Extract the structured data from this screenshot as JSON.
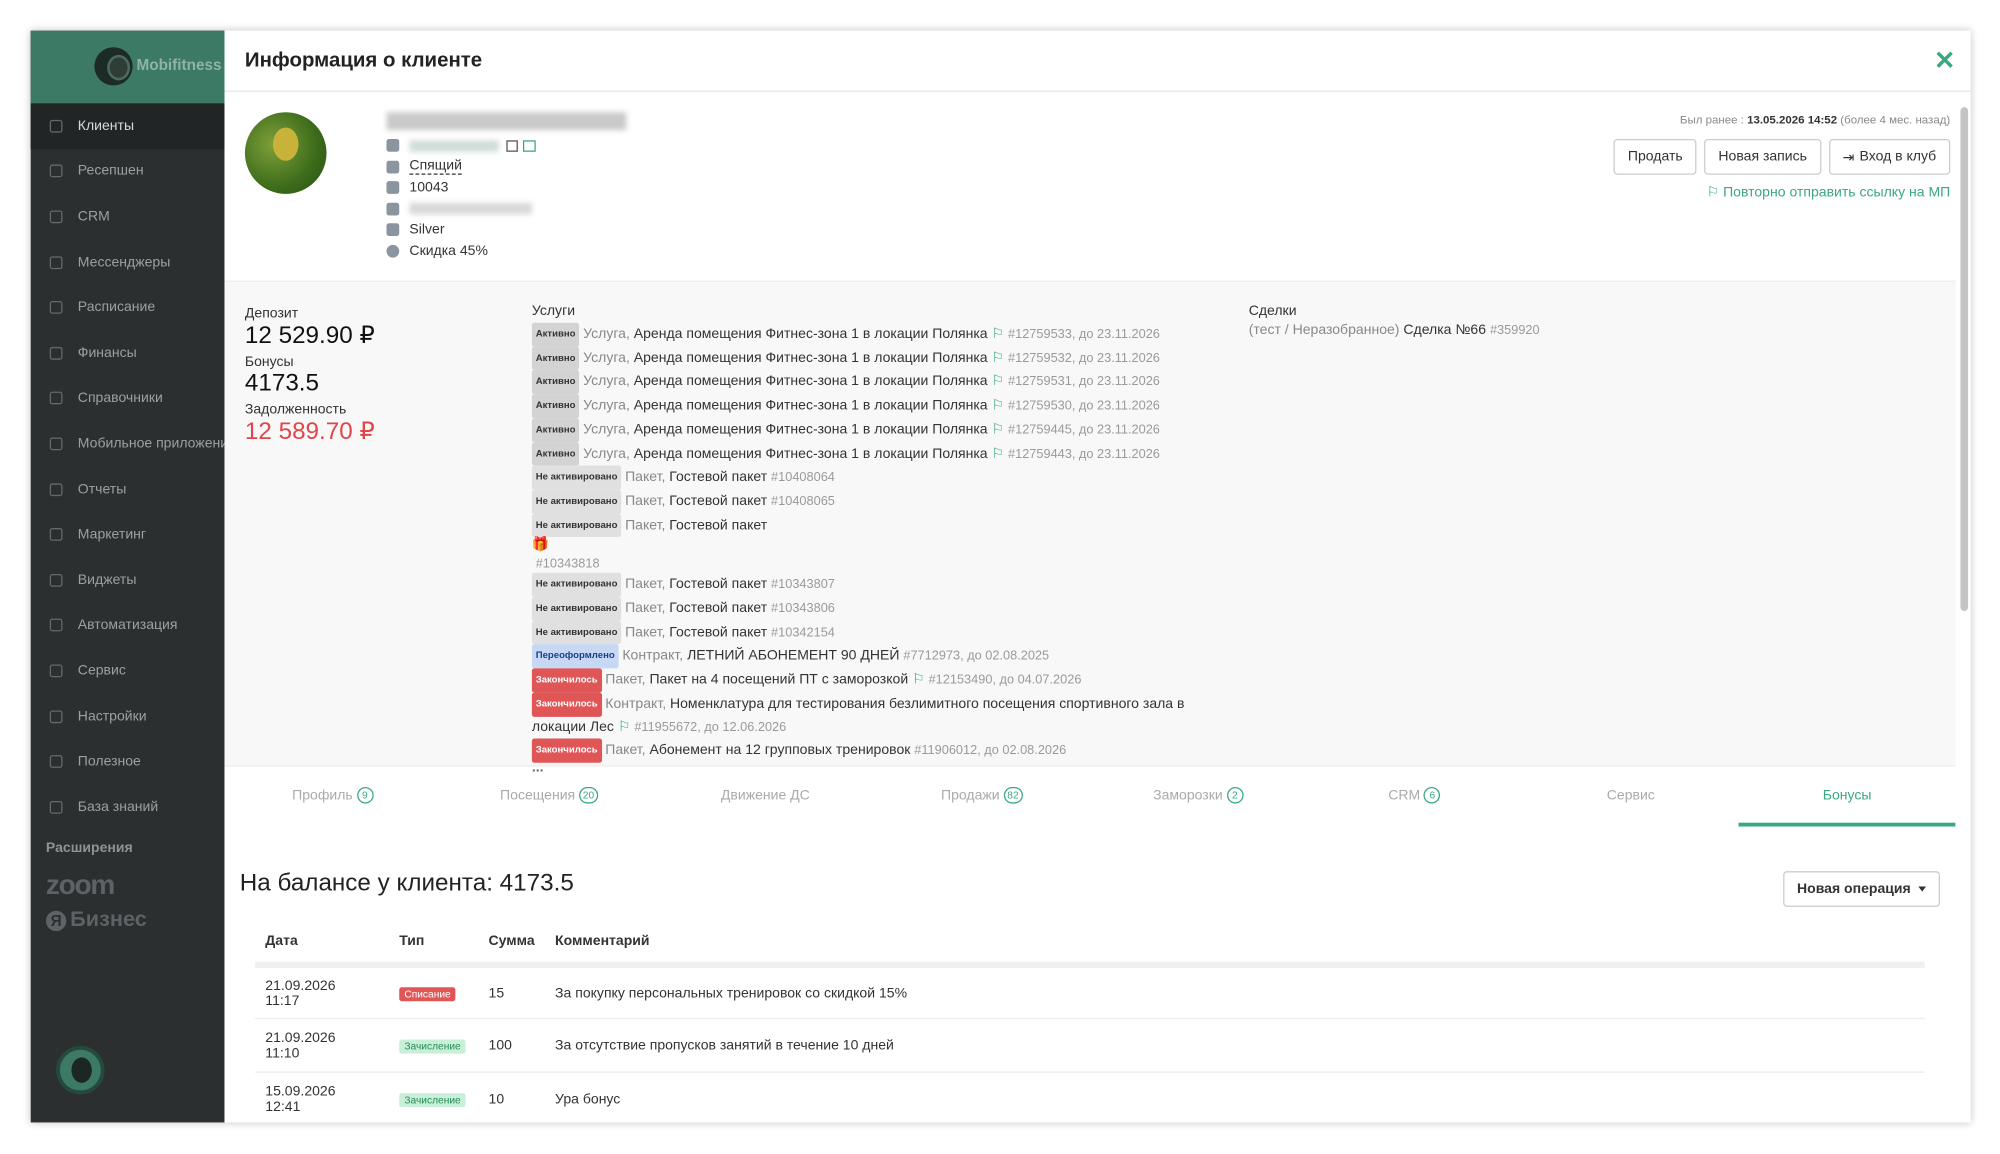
{
  "sidebar": {
    "logo_text": "Mobifitness",
    "items": [
      {
        "label": "Клиенты",
        "icon": "users-icon"
      },
      {
        "label": "Ресепшен",
        "icon": "reception-icon"
      },
      {
        "label": "CRM",
        "icon": "list-icon"
      },
      {
        "label": "Мессенджеры",
        "icon": "chat-icon"
      },
      {
        "label": "Расписание",
        "icon": "calendar-icon"
      },
      {
        "label": "Финансы",
        "icon": "cart-icon"
      },
      {
        "label": "Справочники",
        "icon": "home-icon"
      },
      {
        "label": "Мобильное приложение",
        "icon": "mobile-icon"
      },
      {
        "label": "Отчеты",
        "icon": "chart-icon"
      },
      {
        "label": "Маркетинг",
        "icon": "megaphone-icon"
      },
      {
        "label": "Виджеты",
        "icon": "tag-icon"
      },
      {
        "label": "Автоматизация",
        "icon": "rocket-icon"
      },
      {
        "label": "Сервис",
        "icon": "wrench-icon"
      },
      {
        "label": "Настройки",
        "icon": "gear-icon"
      },
      {
        "label": "Полезное",
        "icon": "thumbs-up-icon"
      },
      {
        "label": "База знаний",
        "icon": "help-icon"
      }
    ],
    "extensions_title": "Расширения",
    "ext_zoom": "zoom",
    "ext_ya_letter": "Я",
    "ext_ya": "Бизнес"
  },
  "header": {
    "title": "Информация о клиенте",
    "close": "✕"
  },
  "client": {
    "status": "Спящий",
    "card": "10043",
    "level": "Silver",
    "discount": "Скидка 45%",
    "last_visit_label": "Был ранее :",
    "last_visit_date": "13.05.2026 14:52",
    "last_visit_rel": "(более 4 мес. назад)"
  },
  "actions": {
    "sell": "Продать",
    "new_record": "Новая запись",
    "enter": "Вход в клуб",
    "resend": "Повторно отправить ссылку на МП"
  },
  "finance": {
    "deposit_label": "Депозит",
    "deposit": "12 529.90 ₽",
    "bonus_label": "Бонусы",
    "bonus": "4173.5",
    "debt_label": "Задолженность",
    "debt": "12 589.70 ₽"
  },
  "services": {
    "title": "Услуги",
    "gift_id": "#10343818",
    "ellipsis": "...",
    "rows": [
      {
        "badge": "Активно",
        "cls": "b-active",
        "kind": "Услуга,",
        "name": "Аренда помещения Фитнес-зона 1 в локации Полянка",
        "flag": true,
        "meta": "#12759533, до 23.11.2026"
      },
      {
        "badge": "Активно",
        "cls": "b-active",
        "kind": "Услуга,",
        "name": "Аренда помещения Фитнес-зона 1 в локации Полянка",
        "flag": true,
        "meta": "#12759532, до 23.11.2026"
      },
      {
        "badge": "Активно",
        "cls": "b-active",
        "kind": "Услуга,",
        "name": "Аренда помещения Фитнес-зона 1 в локации Полянка",
        "flag": true,
        "meta": "#12759531, до 23.11.2026"
      },
      {
        "badge": "Активно",
        "cls": "b-active",
        "kind": "Услуга,",
        "name": "Аренда помещения Фитнес-зона 1 в локации Полянка",
        "flag": true,
        "meta": "#12759530, до 23.11.2026"
      },
      {
        "badge": "Активно",
        "cls": "b-active",
        "kind": "Услуга,",
        "name": "Аренда помещения Фитнес-зона 1 в локации Полянка",
        "flag": true,
        "meta": "#12759445, до 23.11.2026"
      },
      {
        "badge": "Активно",
        "cls": "b-active",
        "kind": "Услуга,",
        "name": "Аренда помещения Фитнес-зона 1 в локации Полянка",
        "flag": true,
        "meta": "#12759443, до 23.11.2026"
      },
      {
        "badge": "Не активировано",
        "cls": "b-inactive",
        "kind": "Пакет,",
        "name": "Гостевой пакет",
        "flag": false,
        "meta": "#10408064"
      },
      {
        "badge": "Не активировано",
        "cls": "b-inactive",
        "kind": "Пакет,",
        "name": "Гостевой пакет",
        "flag": false,
        "meta": "#10408065"
      },
      {
        "badge": "Не активировано",
        "cls": "b-inactive",
        "kind": "Пакет,",
        "name": "Гостевой пакет",
        "flag": false,
        "meta": ""
      },
      {
        "gift": true
      },
      {
        "badge": "Не активировано",
        "cls": "b-inactive",
        "kind": "Пакет,",
        "name": "Гостевой пакет",
        "flag": false,
        "meta": "#10343807"
      },
      {
        "badge": "Не активировано",
        "cls": "b-inactive",
        "kind": "Пакет,",
        "name": "Гостевой пакет",
        "flag": false,
        "meta": "#10343806"
      },
      {
        "badge": "Не активировано",
        "cls": "b-inactive",
        "kind": "Пакет,",
        "name": "Гостевой пакет",
        "flag": false,
        "meta": "#10342154"
      },
      {
        "badge": "Переоформлено",
        "cls": "b-reissued",
        "kind": "Контракт,",
        "name": "ЛЕТНИЙ АБОНЕМЕНТ 90 ДНЕЙ",
        "flag": false,
        "meta": "#7712973, до 02.08.2025"
      },
      {
        "badge": "Закончилось",
        "cls": "b-ended",
        "kind": "Пакет,",
        "name": "Пакет на 4 посещений ПТ с заморозкой",
        "flag": true,
        "meta": "#12153490, до 04.07.2026"
      },
      {
        "badge": "Закончилось",
        "cls": "b-ended",
        "kind": "Контракт,",
        "name": "Номенклатура для тестирования безлимитного посещения спортивного зала в локации Лес",
        "flag": true,
        "meta": "#11955672, до 12.06.2026"
      },
      {
        "badge": "Закончилось",
        "cls": "b-ended",
        "kind": "Пакет,",
        "name": "Абонемент на 12 групповых тренировок",
        "flag": false,
        "meta": "#11906012, до 02.08.2026"
      }
    ]
  },
  "deals": {
    "title": "Сделки",
    "line_prefix": "(тест / Неразобранное)",
    "line_name": "Сделка №66",
    "line_id": "#359920"
  },
  "tabs": [
    {
      "label": "Профиль",
      "count": "9"
    },
    {
      "label": "Посещения",
      "count": "20"
    },
    {
      "label": "Движение ДС",
      "count": ""
    },
    {
      "label": "Продажи",
      "count": "82"
    },
    {
      "label": "Заморозки",
      "count": "2"
    },
    {
      "label": "CRM",
      "count": "6"
    },
    {
      "label": "Сервис",
      "count": ""
    },
    {
      "label": "Бонусы",
      "count": "",
      "selected": true
    }
  ],
  "bonuses": {
    "title": "На балансе у клиента: 4173.5",
    "new_operation": "Новая операция",
    "columns": [
      "Дата",
      "Тип",
      "Сумма",
      "Комментарий"
    ],
    "rows": [
      {
        "date": "21.09.2026",
        "time": "11:17",
        "type": "Списание",
        "type_cls": "t-debit",
        "sum": "15",
        "comment": "За покупку персональных тренировок со скидкой 15%"
      },
      {
        "date": "21.09.2026",
        "time": "11:10",
        "type": "Зачисление",
        "type_cls": "t-credit",
        "sum": "100",
        "comment": "За отсутствие пропусков занятий в течение 10 дней"
      },
      {
        "date": "15.09.2026",
        "time": "12:41",
        "type": "Зачисление",
        "type_cls": "t-credit",
        "sum": "10",
        "comment": "Ура бонус"
      }
    ]
  }
}
